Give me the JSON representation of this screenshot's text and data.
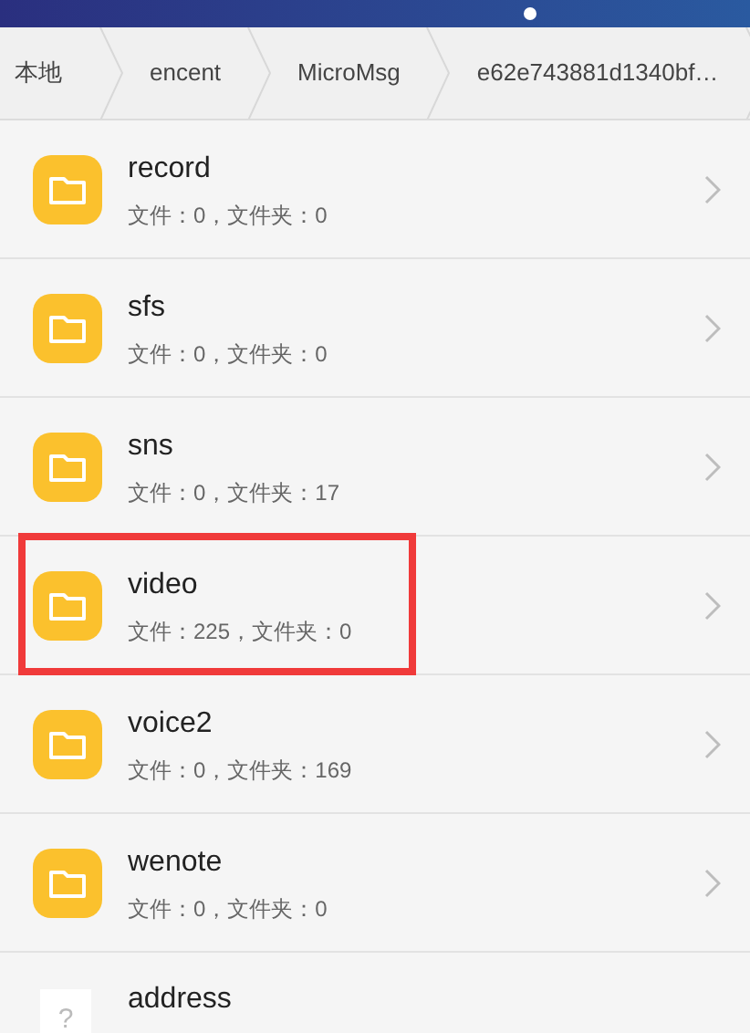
{
  "breadcrumbs": [
    "本地",
    "encent",
    "MicroMsg",
    "e62e743881d1340bf…"
  ],
  "items": [
    {
      "kind": "folder",
      "name": "record",
      "info": "文件：0，文件夹：0",
      "highlighted": false
    },
    {
      "kind": "folder",
      "name": "sfs",
      "info": "文件：0，文件夹：0",
      "highlighted": false
    },
    {
      "kind": "folder",
      "name": "sns",
      "info": "文件：0，文件夹：17",
      "highlighted": false
    },
    {
      "kind": "folder",
      "name": "video",
      "info": "文件：225，文件夹：0",
      "highlighted": true
    },
    {
      "kind": "folder",
      "name": "voice2",
      "info": "文件：0，文件夹：169",
      "highlighted": false
    },
    {
      "kind": "folder",
      "name": "wenote",
      "info": "文件：0，文件夹：0",
      "highlighted": false
    },
    {
      "kind": "file",
      "name": "address",
      "glyph": "?",
      "highlighted": false
    }
  ]
}
